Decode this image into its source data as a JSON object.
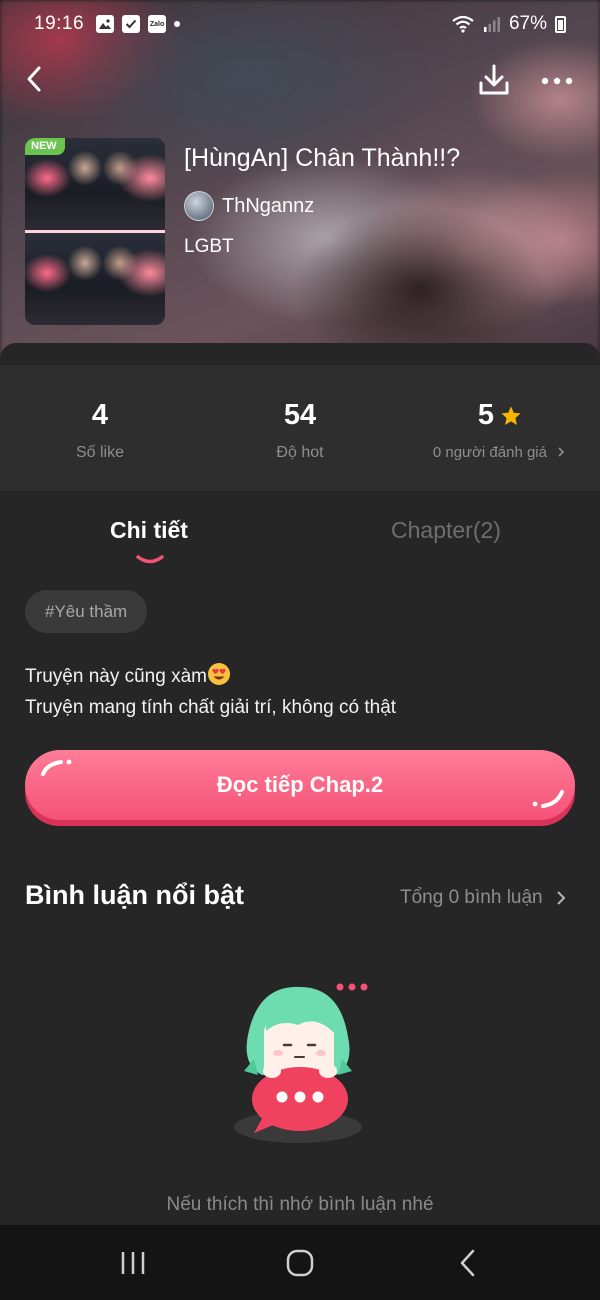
{
  "status_bar": {
    "time": "19:16",
    "notification_icons": [
      "image-icon",
      "check-icon",
      "zalo-icon",
      "dot-icon"
    ],
    "zalo_label": "Zalo",
    "battery": "67%"
  },
  "nav": {
    "back_icon": "back-arrow-icon",
    "download_icon": "download-icon",
    "more_icon": "more-icon"
  },
  "book": {
    "badge": "NEW",
    "title": "[HùngAn] Chân Thành!!?",
    "author": "ThNgannz",
    "genre": "LGBT"
  },
  "stats": {
    "likes_value": "4",
    "likes_label": "Số like",
    "hot_value": "54",
    "hot_label": "Độ hot",
    "rating_value": "5",
    "rating_label": "0 người đánh giá",
    "star_color": "#f7b500"
  },
  "tabs": {
    "detail": "Chi tiết",
    "chapter": "Chapter(2)",
    "active": "detail"
  },
  "tag": "#Yêu thầm",
  "description": {
    "line1": "Truyện này cũng xàm",
    "line2": "Truyện mang tính chất giải trí, không có thật"
  },
  "read_button": "Đọc tiếp Chap.2",
  "comments": {
    "title": "Bình luận nổi bật",
    "total": "Tổng 0 bình luận",
    "empty_text": "Nếu thích thì nhớ bình luận nhé"
  },
  "colors": {
    "accent": "#f55277",
    "background": "#262626",
    "stats_background": "#2e2e2e",
    "muted_text": "#8e8e8e"
  },
  "system_nav": {
    "recents_icon": "recents-icon",
    "home_icon": "home-icon",
    "back_icon": "system-back-icon"
  }
}
